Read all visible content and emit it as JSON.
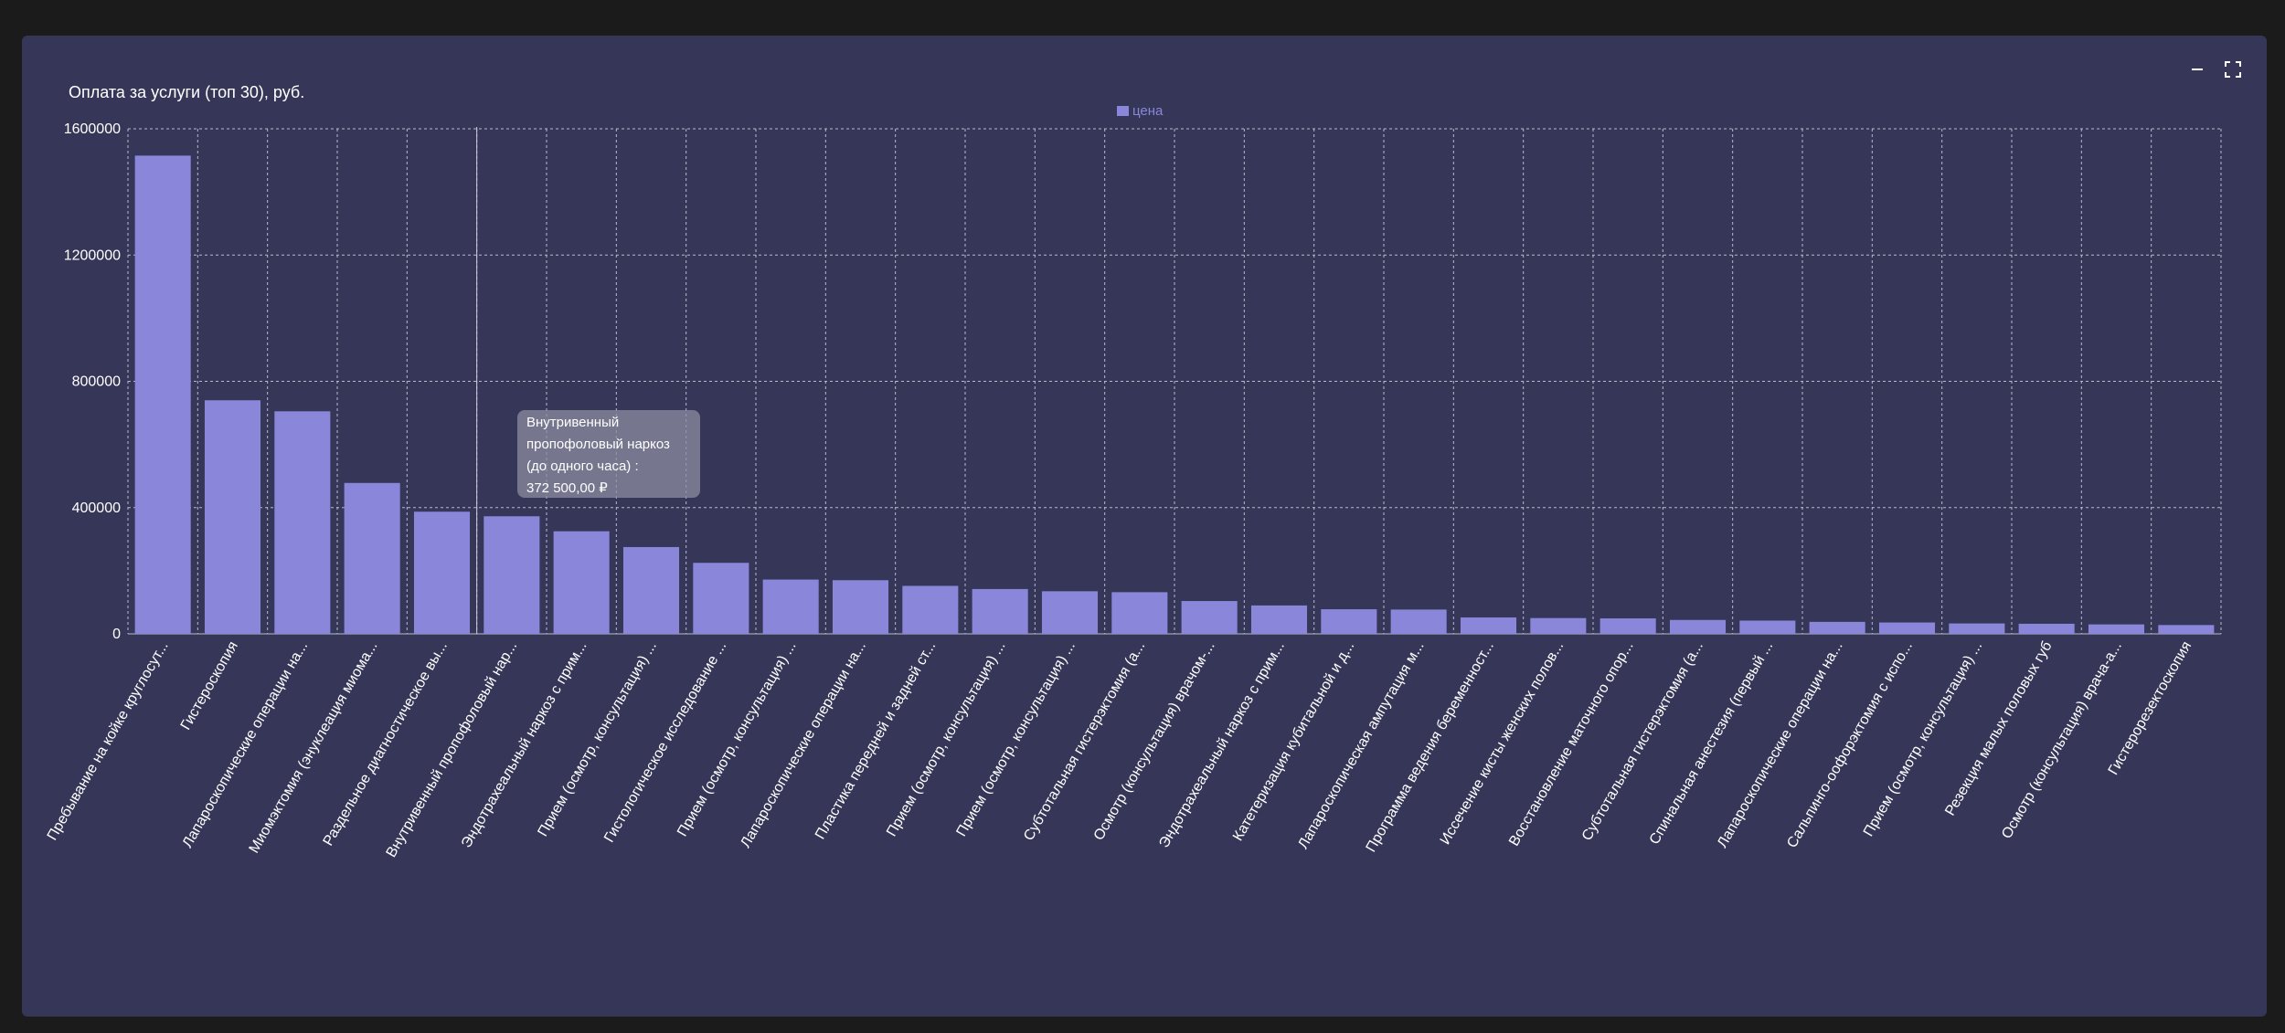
{
  "panel": {
    "title": "Оплата за услуги (топ 30), руб.",
    "minimize_icon": "minimize-icon",
    "fullscreen_icon": "fullscreen-icon"
  },
  "tooltip": {
    "line1": "Внутривенный",
    "line2": "пропофоловый наркоз",
    "line3": "(до одного часа) :",
    "line4": "372 500,00 ₽"
  },
  "colors": {
    "background": "#1b1b1c",
    "panel": "#363758",
    "bar": "#8a86da",
    "grid": "#b8b8cc"
  },
  "chart_data": {
    "type": "bar",
    "title": "Оплата за услуги (топ 30), руб.",
    "legend_position": "top-center",
    "grid": true,
    "ylim": [
      0,
      1600000
    ],
    "yticks": [
      0,
      400000,
      800000,
      1200000,
      1600000
    ],
    "ytick_labels": [
      "0",
      "400000",
      "800000",
      "1200000",
      "1600000"
    ],
    "categories": [
      "Пребывание на койке круглосут...",
      "Гистероскопия",
      "Лапароскопические операции на...",
      "Миомэктомия (энуклеация миома...",
      "Раздельное диагностическое вы...",
      "Внутривенный пропофоловый нар...",
      "Эндотрахеальный наркоз с прим...",
      "Прием (осмотр, консультация) ...",
      "Гистологическое исследование ...",
      "Прием (осмотр, консультация) ...",
      "Лапароскопические операции на...",
      "Пластика передней и задней ст...",
      "Прием (осмотр, консультация) ...",
      "Прием (осмотр, консультация) ...",
      "Субтотальная гистерэктомия (а...",
      "Осмотр (консультация) врачом-...",
      "Эндотрахеальный наркоз с прим...",
      "Катетеризация кубитальной и д...",
      "Лапароскопическая ампутация м...",
      "Программа ведения беременност...",
      "Иссечение кисты женских полов...",
      "Восстановление маточного опор...",
      "Субтотальная гистерэктомия (а...",
      "Спинальная анестезия (первый ...",
      "Лапароскопические операции на...",
      "Сальпинго-оофорэктомия с испо...",
      "Прием (осмотр, консультация) ...",
      "Резекция малых половых губ",
      "Осмотр (консультация) врача-а...",
      "Гистерорезектоскопия"
    ],
    "series": [
      {
        "name": "цена",
        "color": "#8a86da",
        "values": [
          1515000,
          740000,
          705000,
          478000,
          387000,
          372500,
          325000,
          275000,
          225000,
          172000,
          170000,
          152000,
          142000,
          135000,
          132000,
          104000,
          90000,
          78000,
          77000,
          52000,
          50000,
          49000,
          44000,
          42000,
          38000,
          36000,
          33000,
          32000,
          30000,
          28000
        ]
      }
    ]
  }
}
